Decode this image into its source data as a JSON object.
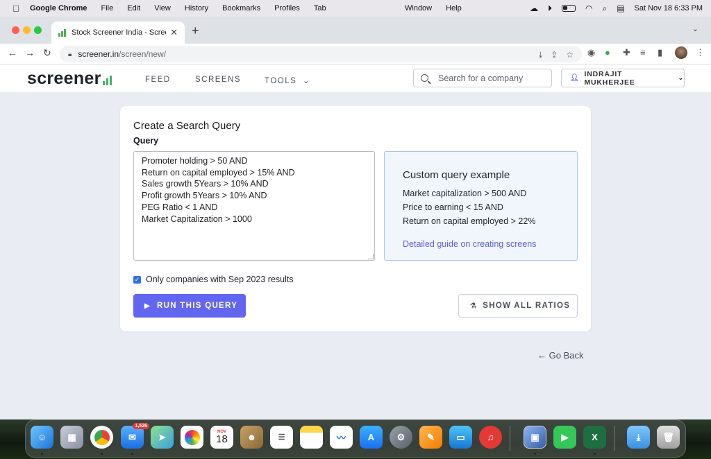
{
  "menubar": {
    "app_name": "Google Chrome",
    "items": [
      "File",
      "Edit",
      "View",
      "History",
      "Bookmarks",
      "Profiles",
      "Tab"
    ],
    "items_mid": [
      "Window",
      "Help"
    ],
    "clock": "Sat Nov 18  6:33 PM"
  },
  "browser": {
    "tab_title": "Stock Screener India - Screen",
    "url_host": "screener.in",
    "url_path": "/screen/new/"
  },
  "site": {
    "logo": "screener",
    "nav": {
      "feed": "FEED",
      "screens": "SCREENS",
      "tools": "TOOLS"
    },
    "search_placeholder": "Search for a company",
    "user_name": "INDRAJIT MUKHERJEE"
  },
  "query_card": {
    "title": "Create a Search Query",
    "query_label": "Query",
    "query_text": "Promoter holding > 50 AND\nReturn on capital employed > 15% AND\nSales growth 5Years > 10% AND\nProfit growth 5Years > 10% AND\nPEG Ratio < 1 AND\nMarket Capitalization > 1000",
    "example": {
      "title": "Custom query example",
      "lines": [
        "Market capitalization > 500 AND",
        "Price to earning < 15 AND",
        "Return on capital employed > 22%"
      ],
      "guide_link": "Detailed guide on creating screens"
    },
    "checkbox_label": "Only companies with Sep 2023 results",
    "checkbox_checked": true,
    "run_button": "RUN THIS QUERY",
    "ratios_button": "SHOW ALL RATIOS"
  },
  "go_back": "← Go Back",
  "dock": {
    "mail_badge": "1,526",
    "calendar_month": "NOV",
    "calendar_day": "18"
  },
  "colors": {
    "accent": "#6366f1",
    "page_bg": "#eaecf3",
    "example_bg": "#f1f6fd",
    "link": "#5b61e0"
  }
}
